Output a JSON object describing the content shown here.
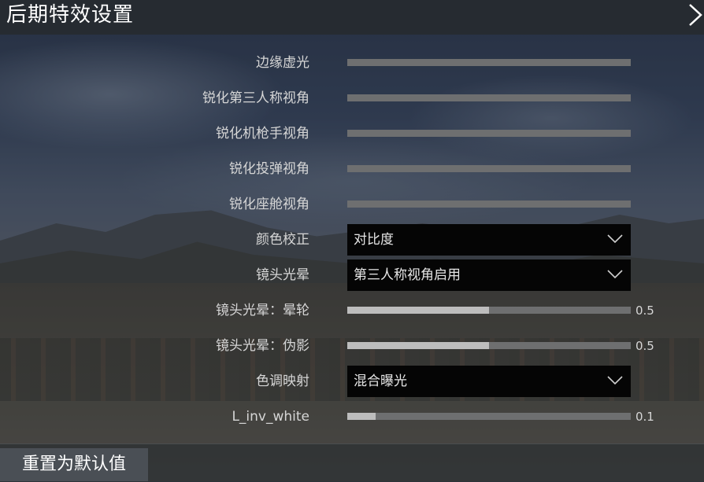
{
  "header": {
    "title": "后期特效设置",
    "close_icon": "chevron-right-icon"
  },
  "settings": [
    {
      "label": "边缘虚光",
      "type": "slider",
      "level": 0
    },
    {
      "label": "锐化第三人称视角",
      "type": "slider",
      "level": 0
    },
    {
      "label": "锐化机枪手视角",
      "type": "slider",
      "level": 0
    },
    {
      "label": "锐化投弹视角",
      "type": "slider",
      "level": 0
    },
    {
      "label": "锐化座舱视角",
      "type": "slider",
      "level": 0
    },
    {
      "label": "颜色校正",
      "type": "dropdown",
      "value": "对比度",
      "icon": "chevron-down-icon"
    },
    {
      "label": "镜头光晕",
      "type": "dropdown",
      "value": "第三人称视角启用",
      "icon": "chevron-down-icon"
    },
    {
      "label": "镜头光晕：晕轮",
      "type": "slider",
      "level": 0.5,
      "value": "0.5"
    },
    {
      "label": "镜头光晕：伪影",
      "type": "slider",
      "level": 0.5,
      "value": "0.5"
    },
    {
      "label": "色调映射",
      "type": "dropdown",
      "value": "混合曝光",
      "icon": "chevron-down-icon"
    },
    {
      "label": "L_inv_white",
      "type": "slider",
      "level": 0.1,
      "value": "0.1"
    }
  ],
  "footer": {
    "reset_label": "重置为默认值"
  },
  "colors": {
    "header_bg": "#262b31",
    "track": "#6e6f70",
    "fill": "#bdbdbd",
    "dropdown_bg": "#050505"
  }
}
